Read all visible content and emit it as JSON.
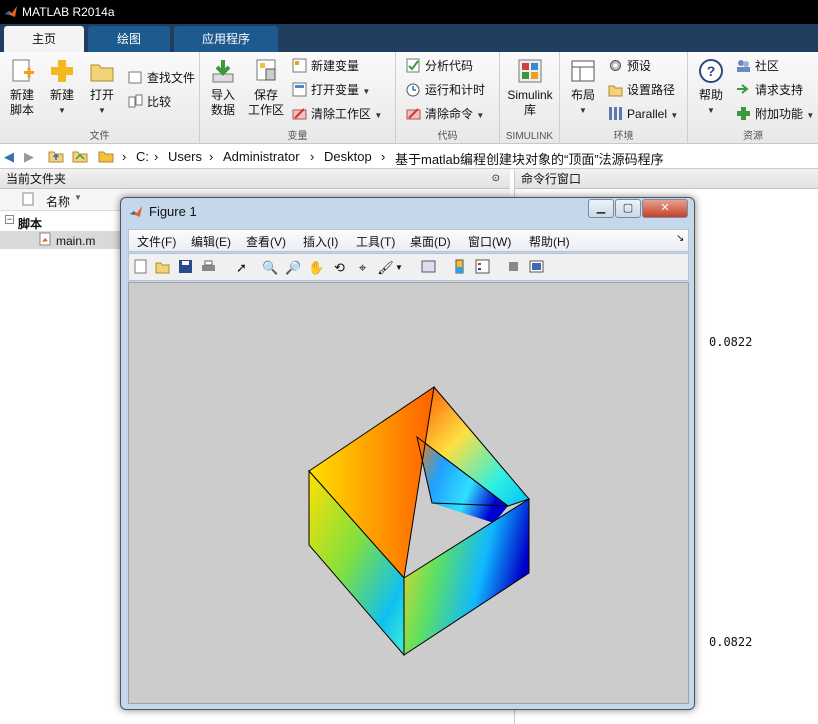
{
  "app": {
    "title": "MATLAB R2014a"
  },
  "tabs": [
    {
      "label": "主页"
    },
    {
      "label": "绘图"
    },
    {
      "label": "应用程序"
    }
  ],
  "ribbon": {
    "file": {
      "label": "文件",
      "new_script": "新建\n脚本",
      "new": "新建",
      "open": "打开",
      "find_files": "查找文件",
      "compare": "比较"
    },
    "variable": {
      "label": "变量",
      "import": "导入\n数据",
      "save_ws": "保存\n工作区",
      "new_var": "新建变量",
      "open_var": "打开变量",
      "clear_ws": "清除工作区"
    },
    "code": {
      "label": "代码",
      "analyze": "分析代码",
      "run_time": "运行和计时",
      "clear_cmd": "清除命令"
    },
    "simulink": {
      "label": "SIMULINK",
      "lib": "Simulink\n库"
    },
    "env": {
      "label": "环境",
      "layout": "布局",
      "prefs": "预设",
      "set_path": "设置路径",
      "parallel": "Parallel"
    },
    "resources": {
      "label": "资源",
      "help": "帮助",
      "community": "社区",
      "support": "请求支持",
      "addons": "附加功能"
    }
  },
  "address": {
    "crumbs": [
      "C:",
      "Users",
      "Administrator",
      "Desktop",
      "基于matlab编程创建块对象的“顶面”法源码程序"
    ]
  },
  "current_folder": {
    "title": "当前文件夹",
    "col_name": "名称",
    "group": "脚本",
    "file": "main.m"
  },
  "command_window": {
    "title": "命令行窗口",
    "values": [
      "0.0822",
      "0.0822"
    ]
  },
  "figure": {
    "title": "Figure 1",
    "menus": [
      "文件(F)",
      "编辑(E)",
      "查看(V)",
      "插入(I)",
      "工具(T)",
      "桌面(D)",
      "窗口(W)",
      "帮助(H)"
    ]
  },
  "colors": {
    "tabbar": "#1f3e60",
    "tab": "#1d5a8e",
    "figure_bg": "#cccccc"
  }
}
